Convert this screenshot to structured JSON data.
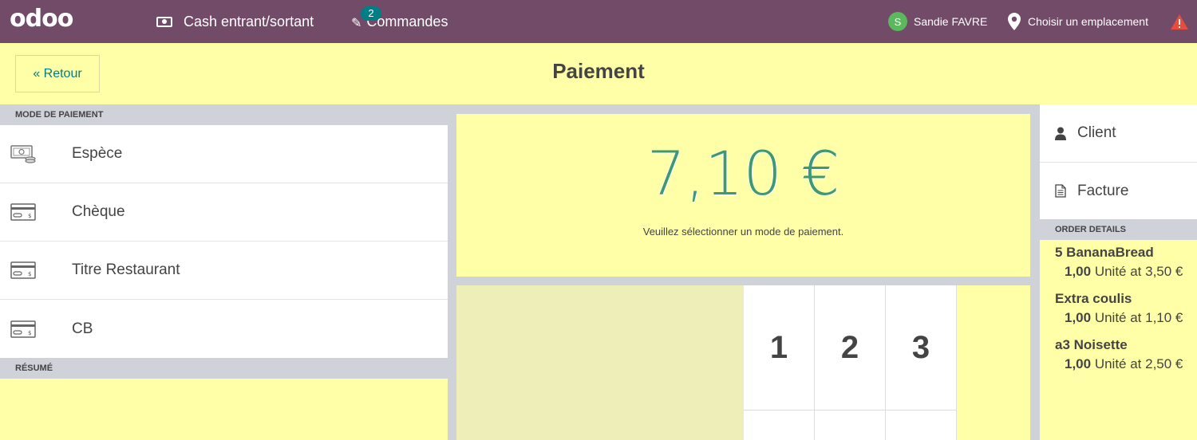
{
  "navbar": {
    "logo": "odoo",
    "cash_label": "Cash entrant/sortant",
    "orders_label": "Commandes",
    "orders_count": "2",
    "user_initial": "S",
    "user_name": "Sandie FAVRE",
    "location_label": "Choisir un emplacement",
    "brand_color": "#714b67"
  },
  "control_bar": {
    "back_label": "« Retour",
    "title": "Paiement"
  },
  "payment_methods": {
    "header": "MODE DE PAIEMENT",
    "items": [
      {
        "label": "Espèce",
        "icon": "cash-icon"
      },
      {
        "label": "Chèque",
        "icon": "card-icon"
      },
      {
        "label": "Titre Restaurant",
        "icon": "card-icon"
      },
      {
        "label": "CB",
        "icon": "card-icon"
      }
    ]
  },
  "summary": {
    "header": "RÉSUMÉ"
  },
  "payment": {
    "amount": "7,10 €",
    "hint": "Veuillez sélectionner un mode de paiement.",
    "amount_color": "#3d9970"
  },
  "numpad": {
    "keys": [
      "1",
      "2",
      "3"
    ]
  },
  "right_panel": {
    "client_label": "Client",
    "invoice_label": "Facture",
    "order_details_header": "ORDER DETAILS",
    "lines": [
      {
        "name": "5 BananaBread",
        "qty": "1,00",
        "info": " Unité at 3,50 €"
      },
      {
        "name": "Extra coulis",
        "qty": "1,00",
        "info": " Unité at 1,10 €"
      },
      {
        "name": "a3 Noisette",
        "qty": "1,00",
        "info": " Unité at 2,50 €"
      }
    ]
  }
}
